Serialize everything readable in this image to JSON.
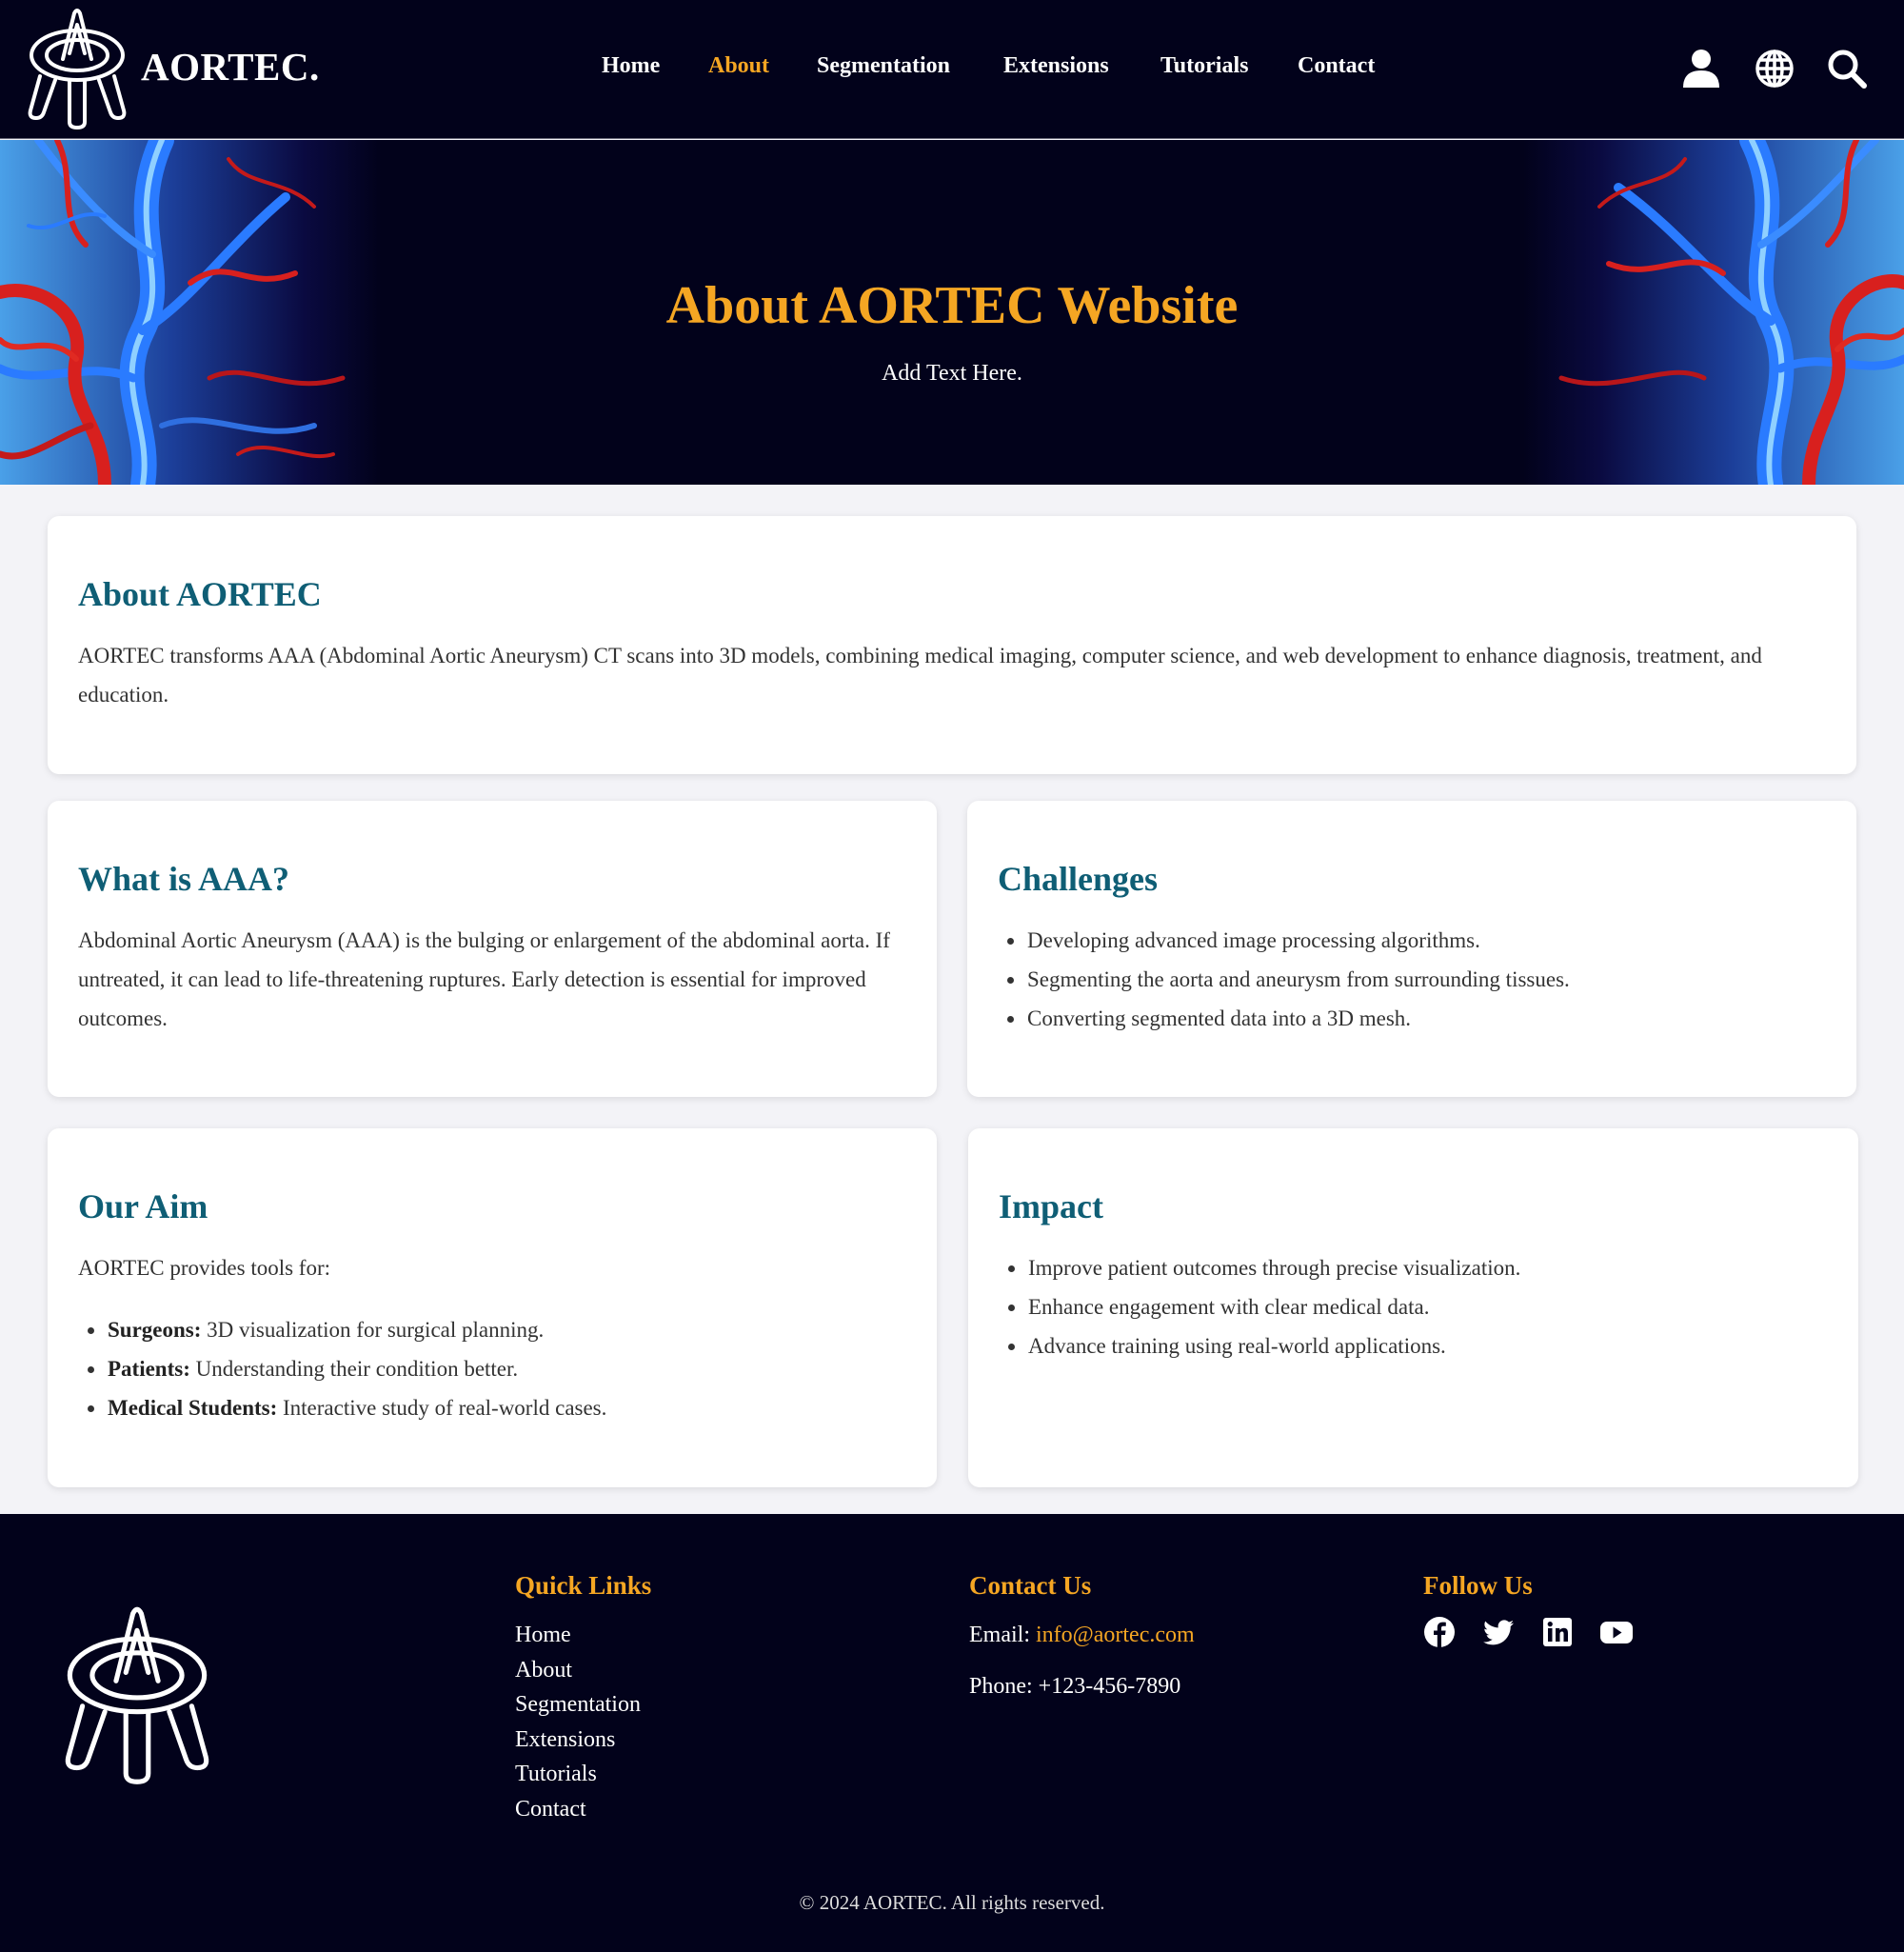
{
  "header": {
    "brand": "AORTEC.",
    "nav": [
      {
        "label": "Home",
        "active": false
      },
      {
        "label": "About",
        "active": true
      },
      {
        "label": "Segmentation",
        "active": false
      },
      {
        "label": "Extensions",
        "active": false
      },
      {
        "label": "Tutorials",
        "active": false
      },
      {
        "label": "Contact",
        "active": false
      }
    ],
    "icons": [
      "user-icon",
      "globe-icon",
      "search-icon"
    ]
  },
  "hero": {
    "title": "About AORTEC Website",
    "subtitle": "Add Text Here."
  },
  "about": {
    "title": "About AORTEC",
    "text": "AORTEC transforms AAA (Abdominal Aortic Aneurysm) CT scans into 3D models, combining medical imaging, computer science, and web development to enhance diagnosis, treatment, and education."
  },
  "what_is": {
    "title": "What is AAA?",
    "text": "Abdominal Aortic Aneurysm (AAA) is the bulging or enlargement of the abdominal aorta. If untreated, it can lead to life-threatening ruptures. Early detection is essential for improved outcomes."
  },
  "challenges": {
    "title": "Challenges",
    "items": [
      "Developing advanced image processing algorithms.",
      "Segmenting the aorta and aneurysm from surrounding tissues.",
      "Converting segmented data into a 3D mesh."
    ]
  },
  "aim": {
    "title": "Our Aim",
    "intro": "AORTEC provides tools for:",
    "items": [
      {
        "bold": "Surgeons:",
        "text": " 3D visualization for surgical planning."
      },
      {
        "bold": "Patients:",
        "text": " Understanding their condition better."
      },
      {
        "bold": "Medical Students:",
        "text": " Interactive study of real-world cases."
      }
    ]
  },
  "impact": {
    "title": "Impact",
    "items": [
      "Improve patient outcomes through precise visualization.",
      "Enhance engagement with clear medical data.",
      "Advance training using real-world applications."
    ]
  },
  "footer": {
    "quick_links_title": "Quick Links",
    "quick_links": [
      "Home",
      "About",
      "Segmentation",
      "Extensions",
      "Tutorials",
      "Contact"
    ],
    "contact_title": "Contact Us",
    "email_label": "Email: ",
    "email": "info@aortec.com",
    "phone": "Phone: +123-456-7890",
    "follow_title": "Follow Us",
    "social": [
      "facebook-icon",
      "twitter-icon",
      "linkedin-icon",
      "youtube-icon"
    ],
    "copyright": "© 2024 AORTEC. All rights reserved."
  },
  "colors": {
    "navy": "#02021b",
    "accent": "#f5a623",
    "heading": "#0f5e75",
    "background": "#f3f3f7"
  }
}
